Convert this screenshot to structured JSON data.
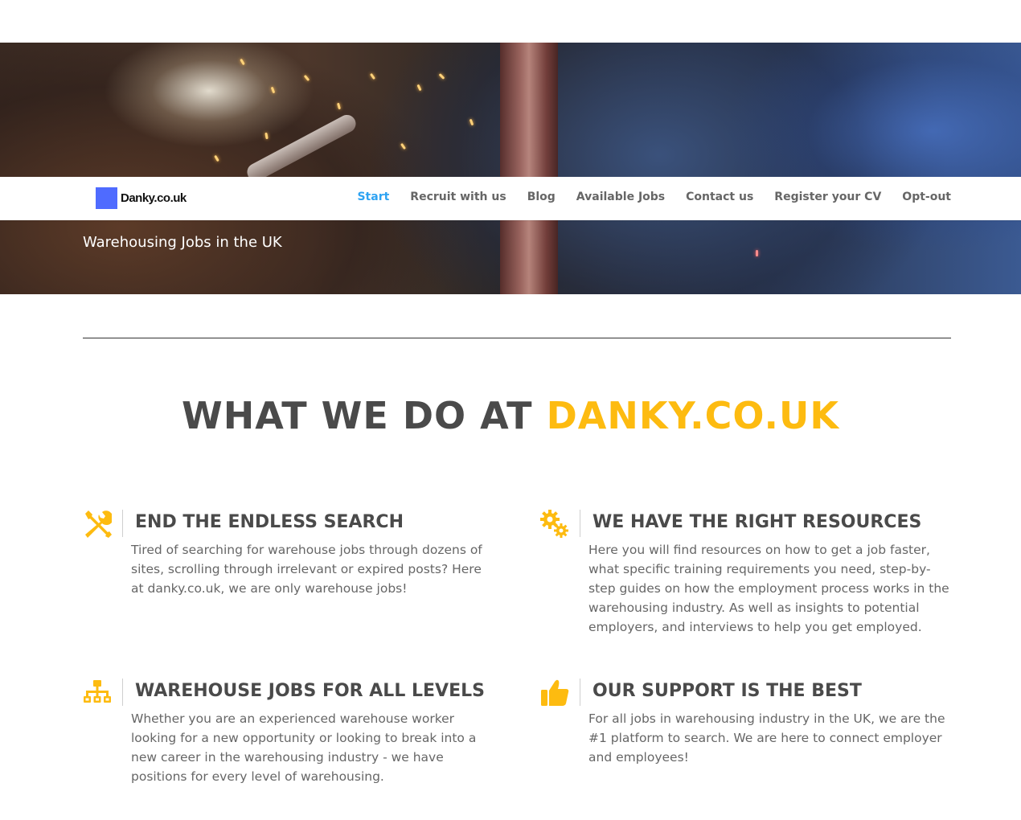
{
  "brand": {
    "logo_text": "Danky.co.uk",
    "logo_color": "#4f6bff"
  },
  "hero": {
    "title": "Warehousing Jobs in the UK"
  },
  "nav": {
    "items": [
      {
        "label": "Start",
        "active": true
      },
      {
        "label": "Recruit with us"
      },
      {
        "label": "Blog"
      },
      {
        "label": "Available Jobs"
      },
      {
        "label": "Contact us"
      },
      {
        "label": "Register your CV"
      },
      {
        "label": "Opt-out"
      }
    ],
    "active_color": "#2ea3f2"
  },
  "headline": {
    "part1": "WHAT WE DO AT ",
    "accent": "DANKY.CO.UK",
    "accent_color": "#fdbb10"
  },
  "features": [
    {
      "icon": "tools-icon",
      "title": "END THE ENDLESS SEARCH",
      "text": "Tired of searching for warehouse jobs through dozens of sites, scrolling through irrelevant or expired posts? Here at danky.co.uk, we are only warehouse jobs!"
    },
    {
      "icon": "gears-icon",
      "title": "WE HAVE THE RIGHT RESOURCES",
      "text": "Here you will find resources on how to get a job faster, what specific training requirements you need, step-by-step guides on how the employment process works in the warehousing industry. As well as insights to potential employers, and interviews to help you get employed."
    },
    {
      "icon": "hierarchy-icon",
      "title": "WAREHOUSE JOBS FOR ALL LEVELS",
      "text": "Whether you are an experienced warehouse worker looking for a new opportunity or looking to break into a new career in the warehousing industry - we have positions for every level of warehousing."
    },
    {
      "icon": "thumbs-up-icon",
      "title": "OUR SUPPORT IS THE BEST",
      "text": "For all jobs in warehousing industry in the UK, we are the #1 platform to search. We are here to connect employer and employees!"
    }
  ]
}
